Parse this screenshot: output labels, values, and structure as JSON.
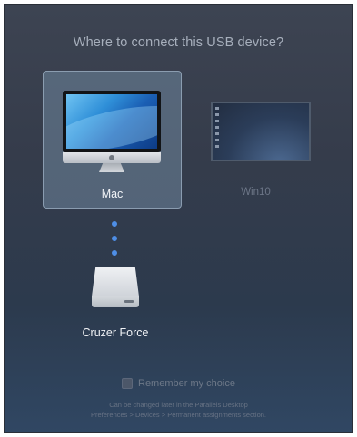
{
  "dialog": {
    "title": "Where to connect this USB device?"
  },
  "targets": [
    {
      "label": "Mac",
      "selected": true,
      "icon": "imac-icon"
    },
    {
      "label": "Win10",
      "selected": false,
      "icon": "windows-vm-thumbnail"
    }
  ],
  "device": {
    "label": "Cruzer Force",
    "icon": "usb-drive-icon"
  },
  "remember": {
    "label": "Remember my choice",
    "checked": false
  },
  "hint": {
    "line1": "Can be changed later in the Parallels Desktop",
    "line2": "Preferences > Devices > Permanent assignments section."
  },
  "colors": {
    "selected_tile": "#70869e",
    "connector_dots": "#4e8ee6"
  }
}
